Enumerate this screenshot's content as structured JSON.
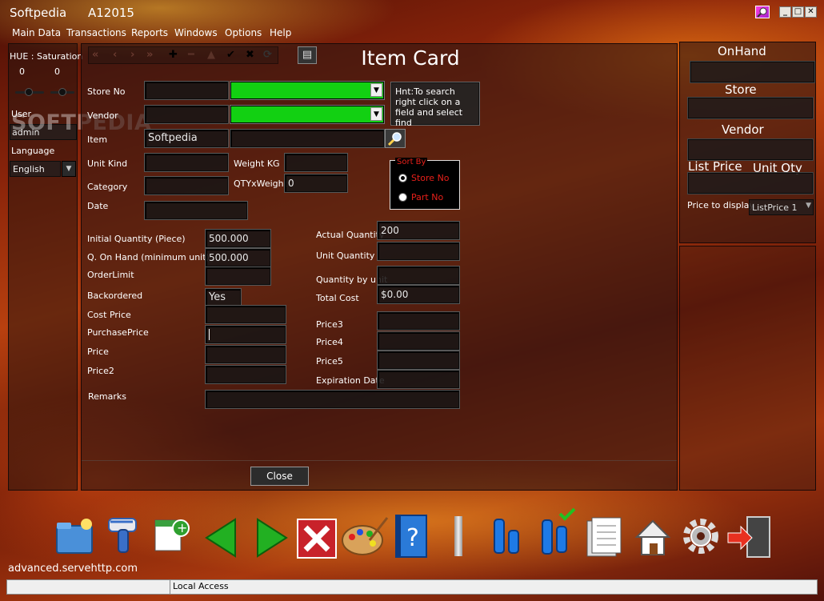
{
  "window": {
    "app_name": "Softpedia",
    "code": "A12015"
  },
  "menu": [
    "Main Data",
    "Transactions",
    "Reports",
    "Windows",
    "Options",
    "Help"
  ],
  "left_panel": {
    "hue_label": "HUE :",
    "saturation_label": "Saturation",
    "hue_value": "0",
    "saturation_value": "0",
    "user_label": "User",
    "user_value": "admin",
    "language_label": "Language",
    "language_value": "English"
  },
  "watermark": "SOFTPEDIA",
  "form": {
    "title": "Item Card",
    "store_no_label": "Store No",
    "vendor_label": "Vendor",
    "item_label": "Item",
    "item_value": "Softpedia",
    "unit_kind_label": "Unit Kind",
    "weight_kg_label": "Weight KG",
    "category_label": "Category",
    "qty_weight_label": "QTYxWeight",
    "qty_weight_value": "0",
    "date_label": "Date",
    "hint": "Hnt:To search right click on a field and select find",
    "sort_by_label": "Sort By",
    "sort_options": [
      "Store No",
      "Part No"
    ],
    "initial_qty_label": "Initial Quantity (Piece)",
    "initial_qty_value": "500.000",
    "on_hand_label": "Q. On Hand (minimum unit)",
    "on_hand_value": "500.000",
    "order_limit_label": "OrderLimit",
    "backordered_label": "Backordered",
    "backordered_value": "Yes",
    "cost_price_label": "Cost Price",
    "purchase_price_label": "PurchasePrice",
    "price_label": "Price",
    "price2_label": "Price2",
    "remarks_label": "Remarks",
    "actual_qty_label": "Actual Quantity",
    "actual_qty_value": "200",
    "unit_qty_label": "Unit Quantity",
    "qty_by_unit_label": "Quantity by unit",
    "total_cost_label": "Total Cost",
    "total_cost_value": "$0.00",
    "price3_label": "Price3",
    "price4_label": "Price4",
    "price5_label": "Price5",
    "expiration_label": "Expiration Date",
    "close_label": "Close"
  },
  "right_panel": {
    "onhand_label": "OnHand",
    "store_label": "Store",
    "vendor_label": "Vendor",
    "list_price_label": "List Price",
    "unit_qty_label": "Unit Qty",
    "price_to_display_label": "Price to display",
    "price_to_display_value": "ListPrice 1"
  },
  "footer": {
    "url": "advanced.servehttp.com",
    "status": "Local Access"
  },
  "colors": {
    "green_field": "#12d012",
    "sort_text": "#e8201a"
  },
  "icons": [
    "folder-icon",
    "barcode-scanner-icon",
    "add-record-icon",
    "back-arrow-icon",
    "forward-arrow-icon",
    "delete-icon",
    "palette-icon",
    "help-book-icon",
    "separator-bar",
    "bars-icon",
    "bars-check-icon",
    "report-pages-icon",
    "home-icon",
    "settings-gear-icon",
    "exit-door-icon"
  ]
}
